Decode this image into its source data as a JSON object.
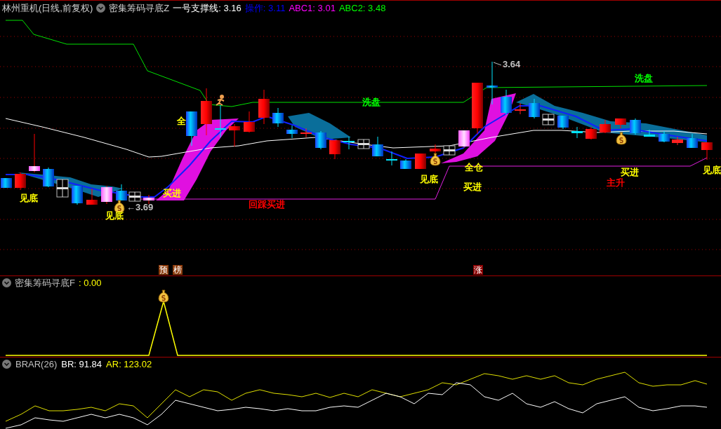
{
  "main_panel": {
    "header": {
      "stock": "林州重机(日线,前复权)",
      "indicator": "密集筹码寻底Z",
      "readings": [
        {
          "label": "一号支撑线:",
          "value": "3.16",
          "color": "#ffffff"
        },
        {
          "label": "操作:",
          "value": "3.11",
          "color": "#0000ff"
        },
        {
          "label": "ABC1:",
          "value": "3.01",
          "color": "#ff00ff"
        },
        {
          "label": "ABC2:",
          "value": "3.48",
          "color": "#00ff00"
        }
      ]
    },
    "chart_labels": [
      {
        "text": "见底",
        "color": "#ffff00"
      },
      {
        "text": "←3.69",
        "color": "#c0c0c0"
      },
      {
        "text": "见底",
        "color": "#ffff00"
      },
      {
        "text": "全",
        "color": "#ffff00"
      },
      {
        "text": "买进",
        "color": "#ffff00"
      },
      {
        "text": "回踩买进",
        "color": "#ff0000"
      },
      {
        "text": "洗盘",
        "color": "#00ff00"
      },
      {
        "text": "见底",
        "color": "#ffff00"
      },
      {
        "text": "全仓",
        "color": "#ffff00"
      },
      {
        "text": "买进",
        "color": "#ffff00"
      },
      {
        "text": "3.64",
        "color": "#c0c0c0"
      },
      {
        "text": "洗盘",
        "color": "#00ff00"
      },
      {
        "text": "买进",
        "color": "#ffff00"
      },
      {
        "text": "主升",
        "color": "#ff0000"
      },
      {
        "text": "见底",
        "color": "#ffff00"
      }
    ],
    "badges": [
      {
        "text": "预",
        "color": "#8b3a0a"
      },
      {
        "text": "榜",
        "color": "#8b3a0a"
      },
      {
        "text": "涨",
        "color": "#8b0000"
      }
    ]
  },
  "f_panel": {
    "header": {
      "indicator": "密集筹码寻底F",
      "value": ": 0.00"
    }
  },
  "brar_panel": {
    "header": {
      "indicator": "BRAR(26)",
      "br": "BR: 91.84",
      "ar": "AR: 123.02"
    }
  }
}
